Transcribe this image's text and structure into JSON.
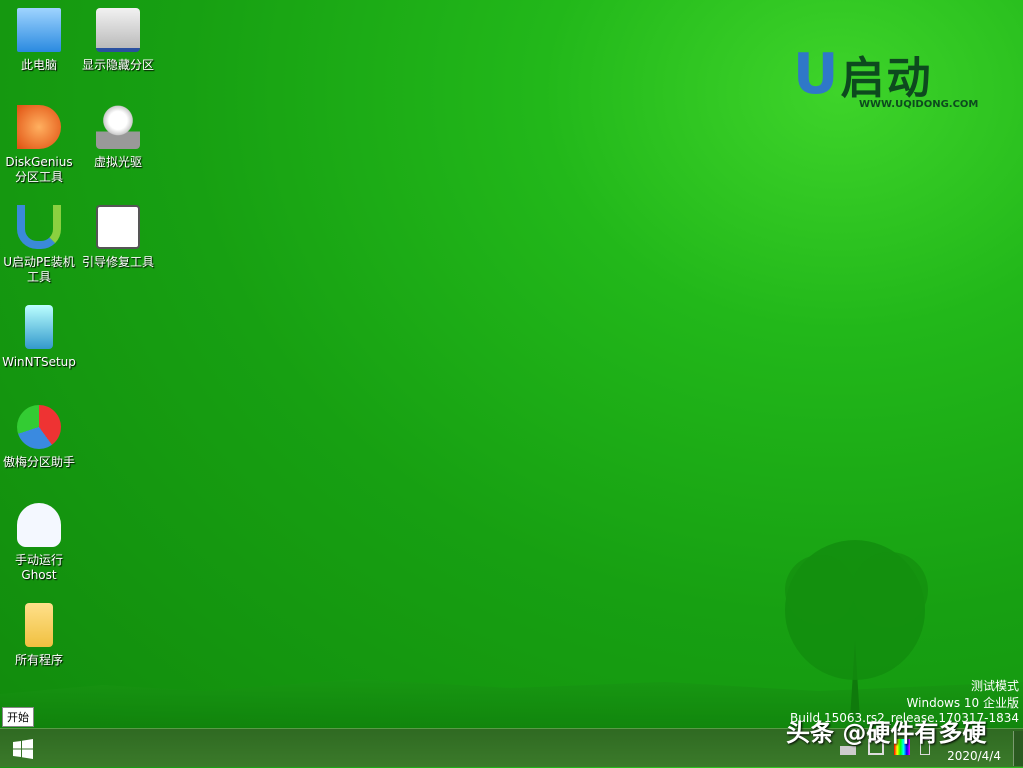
{
  "desktop": {
    "icons": [
      {
        "label": "此电脑",
        "icon": "computer-icon"
      },
      {
        "label": "显示隐藏分区",
        "icon": "drive-icon"
      },
      {
        "label": "DiskGenius\n分区工具",
        "icon": "diskgenius-icon"
      },
      {
        "label": "虚拟光驱",
        "icon": "cd-drive-icon"
      },
      {
        "label": "U启动PE装机\n工具",
        "icon": "uqidong-icon"
      },
      {
        "label": "引导修复工具",
        "icon": "first-aid-icon"
      },
      {
        "label": "WinNTSetup",
        "icon": "winntsetup-icon"
      },
      {
        "label": "傲梅分区助手",
        "icon": "partition-assistant-icon"
      },
      {
        "label": "手动运行\nGhost",
        "icon": "ghost-icon"
      },
      {
        "label": "所有程序",
        "icon": "folder-icon"
      }
    ]
  },
  "logo": {
    "text": "U启动",
    "url": "WWW.UQIDONG.COM"
  },
  "watermark": {
    "mode": "测试模式",
    "edition": "Windows 10 企业版",
    "build": "Build 15063.rs2_release.170317-1834"
  },
  "taskbar": {
    "start_tooltip": "开始",
    "date": "2020/4/4"
  },
  "overlay": "头条 @硬件有多硬",
  "colors": {
    "background": "#17a012",
    "taskbar": "#36722a"
  }
}
